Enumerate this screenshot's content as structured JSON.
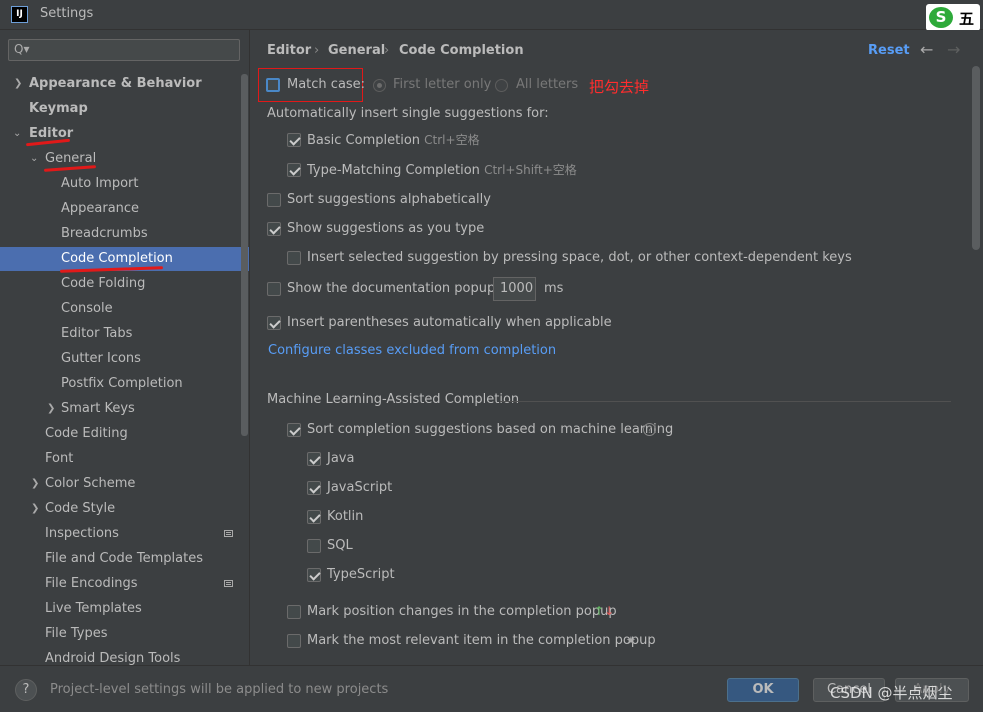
{
  "window": {
    "title": "Settings",
    "app_icon": "IJ",
    "ime_badge": {
      "logo": "S",
      "char": "五"
    }
  },
  "sidebar": {
    "search": {
      "value": "",
      "placeholder": "Q▾"
    },
    "items": [
      {
        "label": "Appearance & Behavior"
      },
      {
        "label": "Keymap"
      },
      {
        "label": "Editor"
      },
      {
        "label": "General"
      },
      {
        "label": "Auto Import"
      },
      {
        "label": "Appearance"
      },
      {
        "label": "Breadcrumbs"
      },
      {
        "label": "Code Completion"
      },
      {
        "label": "Code Folding"
      },
      {
        "label": "Console"
      },
      {
        "label": "Editor Tabs"
      },
      {
        "label": "Gutter Icons"
      },
      {
        "label": "Postfix Completion"
      },
      {
        "label": "Smart Keys"
      },
      {
        "label": "Code Editing"
      },
      {
        "label": "Font"
      },
      {
        "label": "Color Scheme"
      },
      {
        "label": "Code Style"
      },
      {
        "label": "Inspections"
      },
      {
        "label": "File and Code Templates"
      },
      {
        "label": "File Encodings"
      },
      {
        "label": "Live Templates"
      },
      {
        "label": "File Types"
      },
      {
        "label": "Android Design Tools"
      }
    ]
  },
  "breadcrumb": {
    "parts": [
      "Editor",
      "General",
      "Code Completion"
    ],
    "reset": "Reset"
  },
  "settings": {
    "match_case": "Match case:",
    "first_letter_only": "First letter only",
    "all_letters": "All letters",
    "annotation": "把勾去掉",
    "auto_insert_label": "Automatically insert single suggestions for:",
    "basic_completion": "Basic Completion",
    "basic_shortcut": "Ctrl+空格",
    "type_matching": "Type-Matching Completion",
    "type_shortcut": "Ctrl+Shift+空格",
    "sort_alpha": "Sort suggestions alphabetically",
    "show_as_you_type": "Show suggestions as you type",
    "insert_selected": "Insert selected suggestion by pressing space, dot, or other context-dependent keys",
    "show_doc_popup": "Show the documentation popup in",
    "doc_popup_ms": "1000",
    "ms_unit": "ms",
    "insert_parens": "Insert parentheses automatically when applicable",
    "configure_link": "Configure classes excluded from completion",
    "ml_section": "Machine Learning-Assisted Completion",
    "ml_sort": "Sort completion suggestions based on machine learning",
    "languages": [
      "Java",
      "JavaScript",
      "Kotlin",
      "SQL",
      "TypeScript"
    ],
    "mark_position": "Mark position changes in the completion popup",
    "mark_relevant": "Mark the most relevant item in the completion popup"
  },
  "bottom": {
    "help": "?",
    "note": "Project-level settings will be applied to new projects",
    "ok": "OK",
    "cancel": "Cancel",
    "apply": "Apply",
    "watermark": "CSDN @半点烟尘"
  }
}
